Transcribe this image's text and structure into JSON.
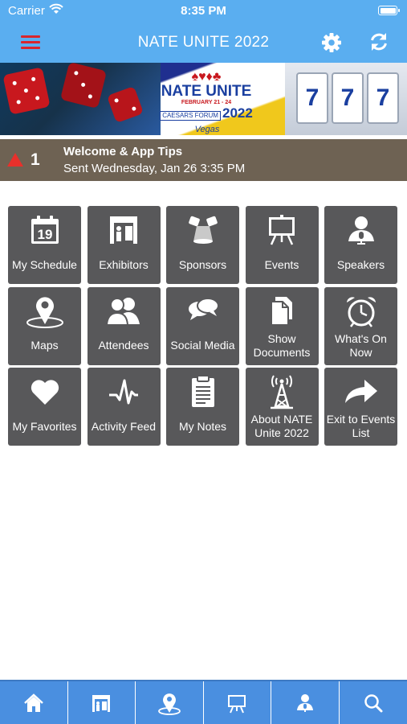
{
  "status": {
    "carrier": "Carrier",
    "time": "8:35 PM"
  },
  "header": {
    "title": "NATE UNITE 2022"
  },
  "banner": {
    "logo_name": "NATE UNITE",
    "logo_dates": "FEBRUARY 21 - 24",
    "logo_sub": "CAESARS FORUM",
    "logo_year": "2022",
    "logo_vegas": "Vegas",
    "slot_symbol": "7"
  },
  "alert": {
    "count": "1",
    "title": "Welcome & App Tips",
    "subtitle": "Sent Wednesday, Jan 26 3:35 PM"
  },
  "tiles": [
    {
      "label": "My Schedule",
      "icon": "calendar-icon",
      "icon_text": "19"
    },
    {
      "label": "Exhibitors",
      "icon": "booth-icon"
    },
    {
      "label": "Sponsors",
      "icon": "spotlight-icon"
    },
    {
      "label": "Events",
      "icon": "easel-icon"
    },
    {
      "label": "Speakers",
      "icon": "speaker-icon"
    },
    {
      "label": "Maps",
      "icon": "map-pin-icon"
    },
    {
      "label": "Attendees",
      "icon": "people-icon"
    },
    {
      "label": "Social Media",
      "icon": "chat-bubbles-icon"
    },
    {
      "label": "Show Documents",
      "icon": "documents-icon"
    },
    {
      "label": "What's On Now",
      "icon": "alarm-clock-icon"
    },
    {
      "label": "My Favorites",
      "icon": "heart-icon"
    },
    {
      "label": "Activity Feed",
      "icon": "pulse-icon"
    },
    {
      "label": "My Notes",
      "icon": "clipboard-icon"
    },
    {
      "label": "About NATE Unite 2022",
      "icon": "tower-icon"
    },
    {
      "label": "Exit to Events List",
      "icon": "exit-arrow-icon"
    }
  ],
  "tabbar": [
    "home-icon",
    "booth-icon",
    "map-pin-icon",
    "easel-icon",
    "speaker-icon",
    "search-icon"
  ],
  "colors": {
    "header": "#5aaef0",
    "tile": "#58585a",
    "alert_bar": "#6e6253",
    "tabbar": "#4a8fe0",
    "menu_accent": "#d8262d"
  }
}
